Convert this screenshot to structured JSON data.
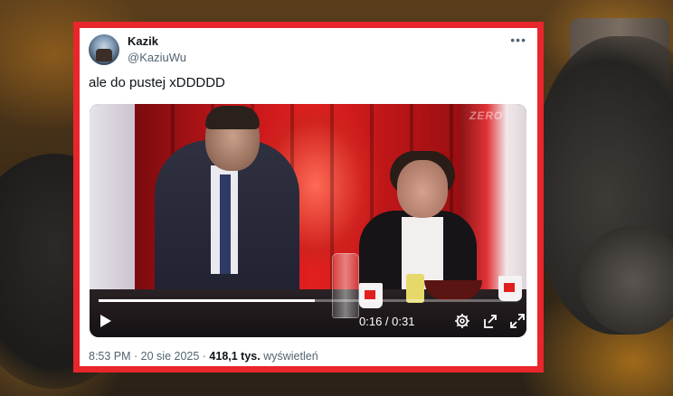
{
  "tweet": {
    "author_name": "Kazik",
    "author_handle": "@KaziuWu",
    "text": "ale do pustej xDDDDD",
    "timestamp": "8:53 PM · 20 sie 2025",
    "views_count": "418,1 tys.",
    "views_label": "wyświetleń"
  },
  "video": {
    "channel_logo": "ZERO",
    "current_time": "0:16",
    "duration": "0:31",
    "time_display": "0:16 / 0:31",
    "progress": 0.516
  },
  "icons": [
    "more-icon",
    "play-icon",
    "settings-icon",
    "share-icon",
    "fullscreen-icon"
  ],
  "colors": {
    "frame_red": "#e8262b",
    "text_primary": "#0f1419",
    "text_secondary": "#536471"
  }
}
